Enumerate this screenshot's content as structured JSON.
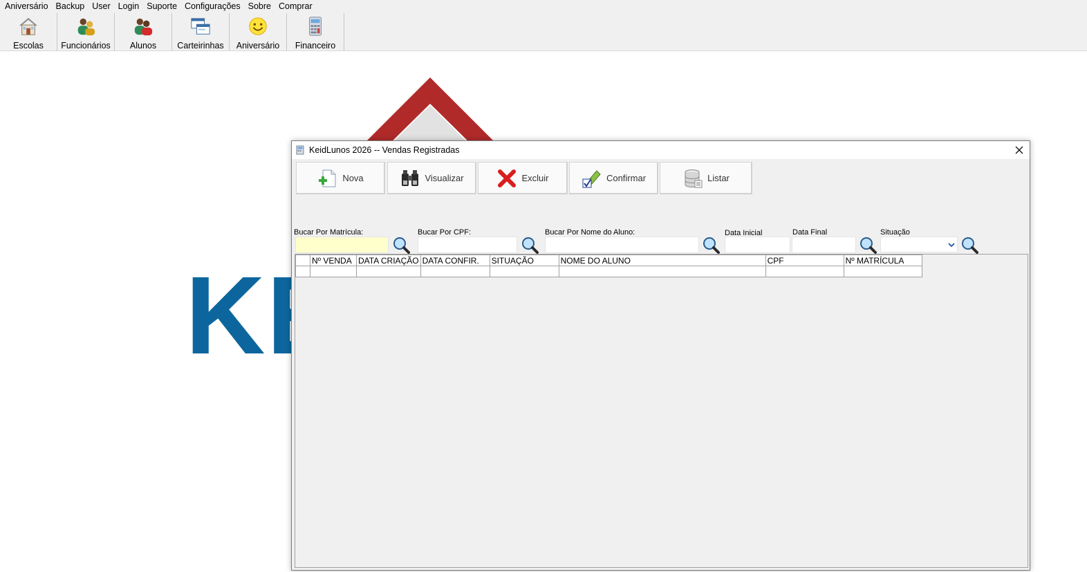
{
  "menubar": {
    "items": [
      "Aniversário",
      "Backup",
      "User",
      "Login",
      "Suporte",
      "Configurações",
      "Sobre",
      "Comprar"
    ]
  },
  "toolbar": {
    "items": [
      {
        "label": "Escolas",
        "icon": "house-icon"
      },
      {
        "label": "Funcionários",
        "icon": "employees-icon"
      },
      {
        "label": "Alunos",
        "icon": "students-icon"
      },
      {
        "label": "Carteirinhas",
        "icon": "cards-icon"
      },
      {
        "label": "Aniversário",
        "icon": "smiley-icon"
      },
      {
        "label": "Financeiro",
        "icon": "calculator-icon"
      }
    ]
  },
  "background": {
    "logo_text": "KE",
    "colors": {
      "roof": "#b02a2a",
      "text": "#0c669d"
    }
  },
  "window": {
    "title": "KeidLunos 2026 -- Vendas Registradas",
    "actions": [
      {
        "label": "Nova",
        "icon": "new-document-icon"
      },
      {
        "label": "Visualizar",
        "icon": "binoculars-icon"
      },
      {
        "label": "Excluir",
        "icon": "delete-x-icon"
      },
      {
        "label": "Confirmar",
        "icon": "pencil-check-icon"
      },
      {
        "label": "Listar",
        "icon": "database-icon"
      }
    ],
    "filters": {
      "matricula_label": "Bucar Por Matrícula:",
      "matricula_value": "",
      "cpf_label": "Bucar Por CPF:",
      "cpf_value": "",
      "nome_label": "Bucar Por Nome do Aluno:",
      "nome_value": "",
      "data_inicial_label": "Data Inicial",
      "data_inicial_value": "",
      "data_final_label": "Data Final",
      "data_final_value": "",
      "situacao_label": "Situação",
      "situacao_value": ""
    },
    "grid": {
      "columns": [
        "Nº VENDA",
        "DATA CRIAÇÃO",
        "DATA CONFIR.",
        "SITUAÇÃO",
        "NOME DO ALUNO",
        "CPF",
        "Nº MATRÍCULA"
      ],
      "rows": [
        [
          "",
          "",
          "",
          "",
          "",
          "",
          ""
        ]
      ]
    }
  }
}
